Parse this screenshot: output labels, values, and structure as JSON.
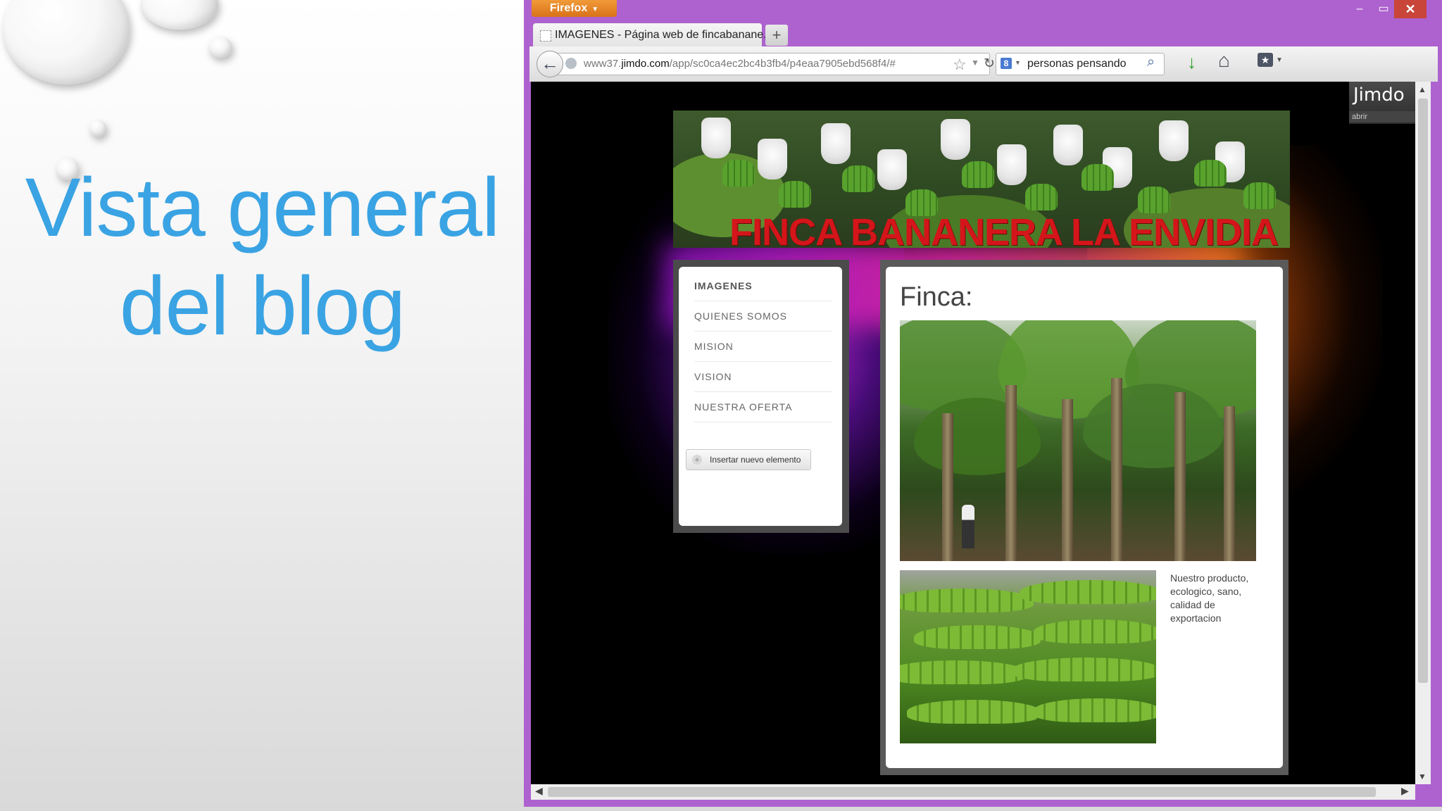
{
  "slide": {
    "title_line1": "Vista general",
    "title_line2": "del blog"
  },
  "browser": {
    "menu_button": "Firefox",
    "tab_title": "IMAGENES - Página web de fincabanane...",
    "url_prefix": "www37.",
    "url_domain": "jimdo.com",
    "url_path": "/app/sc0ca4ec2bc4b3fb4/p4eaa7905ebd568f4/#",
    "search_text": "personas pensando",
    "search_engine": "Google"
  },
  "site": {
    "header_title": "FINCA BANANERA LA ENVIDIA",
    "jimdo_logo": "Jimdo",
    "jimdo_open": "abrir",
    "nav": [
      {
        "label": "IMAGENES",
        "active": true
      },
      {
        "label": "QUIENES SOMOS",
        "active": false
      },
      {
        "label": "MISION",
        "active": false
      },
      {
        "label": "VISION",
        "active": false
      },
      {
        "label": "NUESTRA OFERTA",
        "active": false
      }
    ],
    "insert_button": "Insertar nuevo elemento",
    "content_title": "Finca:",
    "caption": "Nuestro producto, ecologico, sano, calidad de exportacion"
  },
  "colors": {
    "title_blue": "#3aa3e3",
    "window_purple": "#ae62cf",
    "header_red": "#d4151a"
  }
}
